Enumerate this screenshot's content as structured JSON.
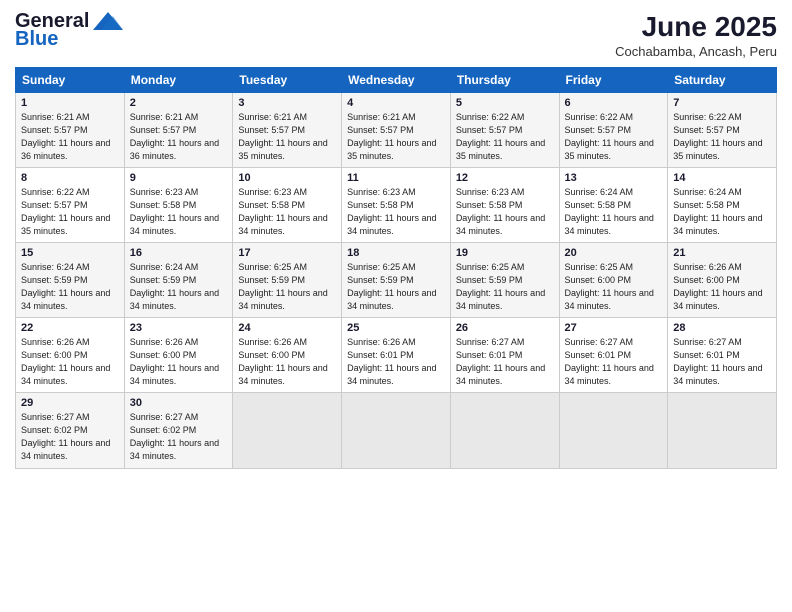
{
  "logo": {
    "line1": "General",
    "line2": "Blue"
  },
  "title": "June 2025",
  "subtitle": "Cochabamba, Ancash, Peru",
  "days_of_week": [
    "Sunday",
    "Monday",
    "Tuesday",
    "Wednesday",
    "Thursday",
    "Friday",
    "Saturday"
  ],
  "weeks": [
    [
      {
        "day": "1",
        "sunrise": "6:21 AM",
        "sunset": "5:57 PM",
        "daylight": "11 hours and 36 minutes."
      },
      {
        "day": "2",
        "sunrise": "6:21 AM",
        "sunset": "5:57 PM",
        "daylight": "11 hours and 36 minutes."
      },
      {
        "day": "3",
        "sunrise": "6:21 AM",
        "sunset": "5:57 PM",
        "daylight": "11 hours and 35 minutes."
      },
      {
        "day": "4",
        "sunrise": "6:21 AM",
        "sunset": "5:57 PM",
        "daylight": "11 hours and 35 minutes."
      },
      {
        "day": "5",
        "sunrise": "6:22 AM",
        "sunset": "5:57 PM",
        "daylight": "11 hours and 35 minutes."
      },
      {
        "day": "6",
        "sunrise": "6:22 AM",
        "sunset": "5:57 PM",
        "daylight": "11 hours and 35 minutes."
      },
      {
        "day": "7",
        "sunrise": "6:22 AM",
        "sunset": "5:57 PM",
        "daylight": "11 hours and 35 minutes."
      }
    ],
    [
      {
        "day": "8",
        "sunrise": "6:22 AM",
        "sunset": "5:57 PM",
        "daylight": "11 hours and 35 minutes."
      },
      {
        "day": "9",
        "sunrise": "6:23 AM",
        "sunset": "5:58 PM",
        "daylight": "11 hours and 34 minutes."
      },
      {
        "day": "10",
        "sunrise": "6:23 AM",
        "sunset": "5:58 PM",
        "daylight": "11 hours and 34 minutes."
      },
      {
        "day": "11",
        "sunrise": "6:23 AM",
        "sunset": "5:58 PM",
        "daylight": "11 hours and 34 minutes."
      },
      {
        "day": "12",
        "sunrise": "6:23 AM",
        "sunset": "5:58 PM",
        "daylight": "11 hours and 34 minutes."
      },
      {
        "day": "13",
        "sunrise": "6:24 AM",
        "sunset": "5:58 PM",
        "daylight": "11 hours and 34 minutes."
      },
      {
        "day": "14",
        "sunrise": "6:24 AM",
        "sunset": "5:58 PM",
        "daylight": "11 hours and 34 minutes."
      }
    ],
    [
      {
        "day": "15",
        "sunrise": "6:24 AM",
        "sunset": "5:59 PM",
        "daylight": "11 hours and 34 minutes."
      },
      {
        "day": "16",
        "sunrise": "6:24 AM",
        "sunset": "5:59 PM",
        "daylight": "11 hours and 34 minutes."
      },
      {
        "day": "17",
        "sunrise": "6:25 AM",
        "sunset": "5:59 PM",
        "daylight": "11 hours and 34 minutes."
      },
      {
        "day": "18",
        "sunrise": "6:25 AM",
        "sunset": "5:59 PM",
        "daylight": "11 hours and 34 minutes."
      },
      {
        "day": "19",
        "sunrise": "6:25 AM",
        "sunset": "5:59 PM",
        "daylight": "11 hours and 34 minutes."
      },
      {
        "day": "20",
        "sunrise": "6:25 AM",
        "sunset": "6:00 PM",
        "daylight": "11 hours and 34 minutes."
      },
      {
        "day": "21",
        "sunrise": "6:26 AM",
        "sunset": "6:00 PM",
        "daylight": "11 hours and 34 minutes."
      }
    ],
    [
      {
        "day": "22",
        "sunrise": "6:26 AM",
        "sunset": "6:00 PM",
        "daylight": "11 hours and 34 minutes."
      },
      {
        "day": "23",
        "sunrise": "6:26 AM",
        "sunset": "6:00 PM",
        "daylight": "11 hours and 34 minutes."
      },
      {
        "day": "24",
        "sunrise": "6:26 AM",
        "sunset": "6:00 PM",
        "daylight": "11 hours and 34 minutes."
      },
      {
        "day": "25",
        "sunrise": "6:26 AM",
        "sunset": "6:01 PM",
        "daylight": "11 hours and 34 minutes."
      },
      {
        "day": "26",
        "sunrise": "6:27 AM",
        "sunset": "6:01 PM",
        "daylight": "11 hours and 34 minutes."
      },
      {
        "day": "27",
        "sunrise": "6:27 AM",
        "sunset": "6:01 PM",
        "daylight": "11 hours and 34 minutes."
      },
      {
        "day": "28",
        "sunrise": "6:27 AM",
        "sunset": "6:01 PM",
        "daylight": "11 hours and 34 minutes."
      }
    ],
    [
      {
        "day": "29",
        "sunrise": "6:27 AM",
        "sunset": "6:02 PM",
        "daylight": "11 hours and 34 minutes."
      },
      {
        "day": "30",
        "sunrise": "6:27 AM",
        "sunset": "6:02 PM",
        "daylight": "11 hours and 34 minutes."
      },
      null,
      null,
      null,
      null,
      null
    ]
  ]
}
